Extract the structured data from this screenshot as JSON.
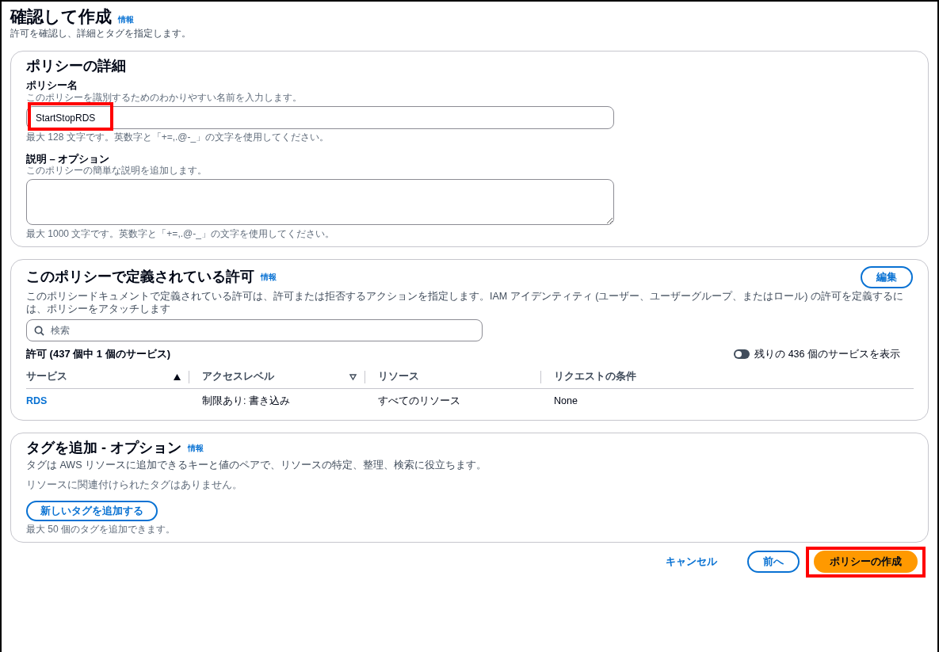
{
  "page": {
    "title": "確認して作成",
    "info_link": "情報",
    "description": "許可を確認し、詳細とタグを指定します。"
  },
  "policy_details": {
    "heading": "ポリシーの詳細",
    "name_field": {
      "label": "ポリシー名",
      "hint": "このポリシーを識別するためのわかりやすい名前を入力します。",
      "value": "StartStopRDS",
      "constraint": "最大 128 文字です。英数字と「+=,.@-_」の文字を使用してください。",
      "highlighted": true
    },
    "description_field": {
      "label": "説明 – オプション",
      "hint": "このポリシーの簡単な説明を追加します。",
      "constraint": "最大 1000 文字です。英数字と「+=,.@-_」の文字を使用してください。"
    }
  },
  "permissions": {
    "heading": "このポリシーで定義されている許可",
    "info_link": "情報",
    "edit_button": "編集",
    "description": "このポリシードキュメントで定義されている許可は、許可または拒否するアクションを指定します。IAM アイデンティティ (ユーザー、ユーザーグループ、またはロール) の許可を定義するには、ポリシーをアタッチします",
    "search": {
      "placeholder": "検索"
    },
    "count_label": "許可 (437 個中 1 個のサービス)",
    "toggle": {
      "label": "残りの 436 個のサービスを表示",
      "on": false
    },
    "table": {
      "columns": [
        {
          "label": "サービス",
          "sorted": true
        },
        {
          "label": "アクセスレベル",
          "sorted": false
        },
        {
          "label": "リソース"
        },
        {
          "label": "リクエストの条件"
        }
      ],
      "rows": [
        {
          "cells": [
            "RDS",
            "制限あり: 書き込み",
            "すべてのリソース",
            "None"
          ]
        }
      ]
    }
  },
  "tags": {
    "heading": "タグを追加 - オプション",
    "info_link": "情報",
    "description": "タグは AWS リソースに追加できるキーと値のペアで、リソースの特定、整理、検索に役立ちます。",
    "empty_text": "リソースに関連付けられたタグはありません。",
    "add_button": "新しいタグを追加する",
    "limit_text": "最大 50 個のタグを追加できます。"
  },
  "footer": {
    "buttons": [
      {
        "label": "キャンセル",
        "kind": "link"
      },
      {
        "label": "前へ",
        "kind": "secondary"
      },
      {
        "label": "ポリシーの作成",
        "kind": "primary",
        "highlighted": true
      }
    ]
  }
}
